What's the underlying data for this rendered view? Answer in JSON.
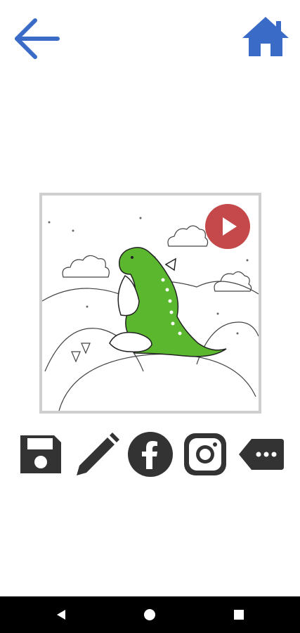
{
  "header": {
    "back_icon": "arrow-left-icon",
    "home_icon": "home-icon"
  },
  "canvas": {
    "play_icon": "play-icon",
    "image": "dragon-coloring-page"
  },
  "share_bar": {
    "items": [
      "save-icon",
      "edit-icon",
      "facebook-icon",
      "instagram-icon",
      "more-icon"
    ]
  },
  "system_nav": {
    "items": [
      "nav-back-icon",
      "nav-home-icon",
      "nav-recents-icon"
    ]
  },
  "colors": {
    "accent_blue": "#3a6bc7",
    "dragon_green": "#5bb82e",
    "play_red": "#c0393b",
    "icon_dark": "#333333",
    "frame_border": "#cfcfcf",
    "navbar": "#000000"
  }
}
